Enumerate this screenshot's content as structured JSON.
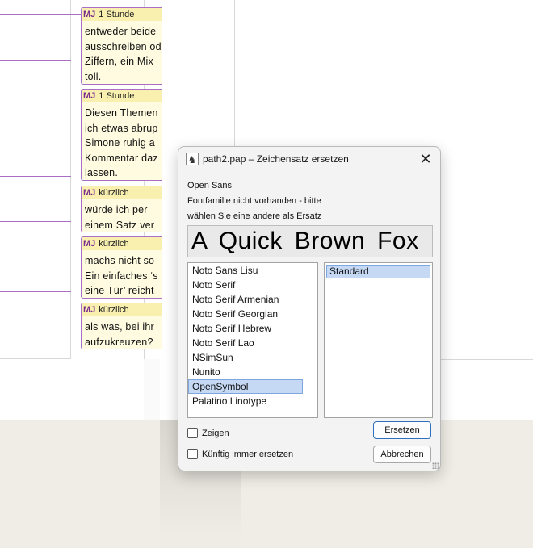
{
  "comments": [
    {
      "author": "MJ",
      "time": "1 Stunde",
      "lines": [
        "entweder beide",
        "ausschreiben od",
        "Ziffern, ein Mix",
        "toll."
      ]
    },
    {
      "author": "MJ",
      "time": "1 Stunde",
      "lines": [
        "Diesen Themen",
        "ich etwas abrup",
        "Simone ruhig a",
        "Kommentar daz",
        "lassen."
      ]
    },
    {
      "author": "MJ",
      "time": "kürzlich",
      "lines": [
        "würde ich per",
        "einem Satz ver"
      ]
    },
    {
      "author": "MJ",
      "time": "kürzlich",
      "lines": [
        "machs nicht so",
        "Ein einfaches ‘s",
        "eine Tür’ reicht"
      ]
    },
    {
      "author": "MJ",
      "time": "kürzlich",
      "lines": [
        "als was, bei ihr",
        "aufzukreuzen?"
      ]
    }
  ],
  "dialog": {
    "title": "path2.pap – Zeichensatz ersetzen",
    "icon": "app-icon",
    "close_label": "✕",
    "font_name": "Open Sans",
    "message_line1": "Fontfamilie nicht vorhanden - bitte",
    "message_line2": "wählen Sie eine andere als Ersatz",
    "preview_text": "A Quick Brown Fox",
    "fonts": [
      "Noto Sans Lisu",
      "Noto Serif",
      "Noto Serif Armenian",
      "Noto Serif Georgian",
      "Noto Serif Hebrew",
      "Noto Serif Lao",
      "NSimSun",
      "Nunito",
      "OpenSymbol",
      "Palatino Linotype"
    ],
    "selected_font": "OpenSymbol",
    "styles": [
      "Standard"
    ],
    "show_label": "Zeigen",
    "always_replace_label": "Künftig immer ersetzen",
    "replace_button": "Ersetzen",
    "cancel_button": "Abbrechen"
  },
  "colors": {
    "comment_border": "#a86fc4",
    "comment_author": "#7b2d8c",
    "selection": "#c5d9f5"
  }
}
